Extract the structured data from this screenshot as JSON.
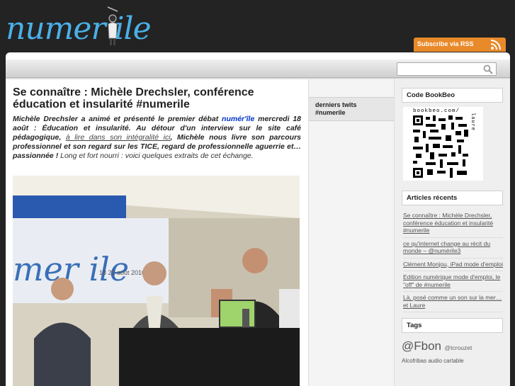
{
  "header": {
    "logo_text": "numer ile",
    "rss_label": "Subscribe via RSS"
  },
  "search": {
    "placeholder": ""
  },
  "post": {
    "title": "Se connaître : Michèle Drechsler, conférence éducation et insularité #numerile",
    "excerpt_1": "Michèle Drechsler a animé et présenté le premier débat ",
    "excerpt_link": "numér'île",
    "excerpt_2": " mercredi 18 août : Éducation et insularité. Au détour d'un interview sur le site café pédagogique, ",
    "excerpt_link2": "à lire dans son intégralité ici",
    "excerpt_3": ", Michèle nous livre son parcours professionnel et son regard sur les TICE, regard de professionnelle aguerrie et… passionnée !",
    "excerpt_rest": " Long et fort nourri : voici quelques extraits de cet échange.",
    "photo_banner_text": "mer ile",
    "photo_dates": "18 22 août 2010"
  },
  "midcol": {
    "twits_title": "derniers twits #numerile"
  },
  "sidebar": {
    "bookbeo_title": "Code BookBeo",
    "qr_label": "bookbeo.com/",
    "qr_side": "laure",
    "recent_title": "Articles récents",
    "recent": [
      "Se connaître : Michèle Drechsler, conférence éducation et insularité #numerile",
      "ce qu'internet change au récit du monde – @numérile3",
      "Clément Monjou, iPad mode d'emploi",
      "Edition numérique mode d'emploi, le \"off\" de #numerile",
      "Là, posé comme un son sur la mer… et Laure"
    ],
    "tags_title": "Tags",
    "tag_big": "@Fbon",
    "tag_small": "@tcrouzet",
    "tag_more": "Alcofribas audio cartable"
  },
  "colors": {
    "accent_blue": "#4ab0e8",
    "rss_orange": "#e98a2a",
    "background": "#232323"
  }
}
